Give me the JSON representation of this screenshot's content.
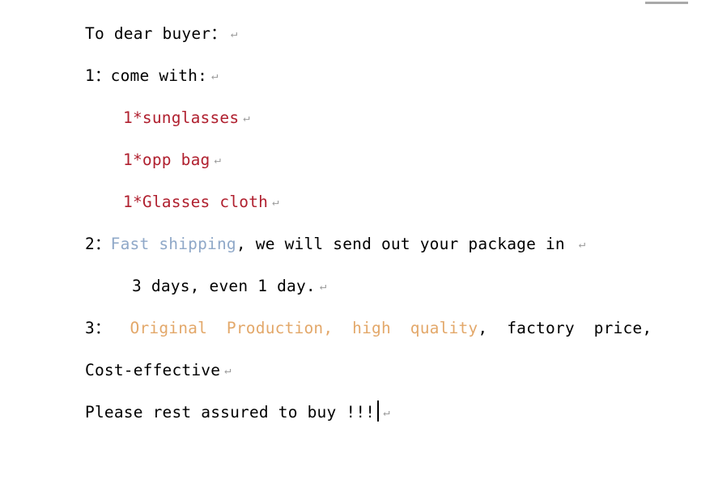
{
  "document": {
    "background_color": "#ffffff",
    "colors": {
      "body_text": "#000000",
      "red": "#b0202f",
      "blue": "#8fa8c8",
      "orange": "#e3a86a",
      "return_mark": "#9b9b9b"
    },
    "return_mark_glyph": "↵",
    "lines": [
      {
        "id": "greeting",
        "indent": "margin",
        "has_return_mark": true,
        "segments": [
          {
            "text": "To dear buyer：",
            "color": "black"
          }
        ]
      },
      {
        "id": "item-1-heading",
        "indent": "margin",
        "has_return_mark": true,
        "segments": [
          {
            "text": "1：come with:",
            "color": "black"
          }
        ]
      },
      {
        "id": "included-sunglasses",
        "indent": "indent-1",
        "has_return_mark": true,
        "segments": [
          {
            "text": "1*sunglasses",
            "color": "red"
          }
        ]
      },
      {
        "id": "included-opp-bag",
        "indent": "indent-1",
        "has_return_mark": true,
        "segments": [
          {
            "text": "1*opp bag",
            "color": "red"
          }
        ]
      },
      {
        "id": "included-glasses-cloth",
        "indent": "indent-1",
        "has_return_mark": true,
        "segments": [
          {
            "text": "1*Glasses cloth",
            "color": "red"
          }
        ]
      },
      {
        "id": "item-2-shipping",
        "indent": "margin",
        "has_return_mark": true,
        "segments": [
          {
            "text": "2：",
            "color": "black"
          },
          {
            "text": "Fast shipping",
            "color": "blue"
          },
          {
            "text": ", we will send out your package in ",
            "color": "black"
          }
        ]
      },
      {
        "id": "item-2-shipping-continued",
        "indent": "indent-2",
        "has_return_mark": true,
        "segments": [
          {
            "text": "3 days, even 1 day.",
            "color": "black"
          }
        ]
      },
      {
        "id": "item-3-quality",
        "indent": "margin",
        "has_return_mark": false,
        "segments": [
          {
            "text": "3：  ",
            "color": "black"
          },
          {
            "text": "Original  Production,  high  quality",
            "color": "orange"
          },
          {
            "text": ",  factory  price,",
            "color": "black"
          }
        ]
      },
      {
        "id": "item-3-cost-effective",
        "indent": "margin",
        "has_return_mark": true,
        "segments": [
          {
            "text": "Cost-effective",
            "color": "black"
          }
        ]
      },
      {
        "id": "closing-call-to-action",
        "indent": "margin",
        "has_return_mark": false,
        "has_caret": true,
        "segments": [
          {
            "text": "Please rest assured to buy !!!",
            "color": "black"
          }
        ]
      }
    ]
  }
}
